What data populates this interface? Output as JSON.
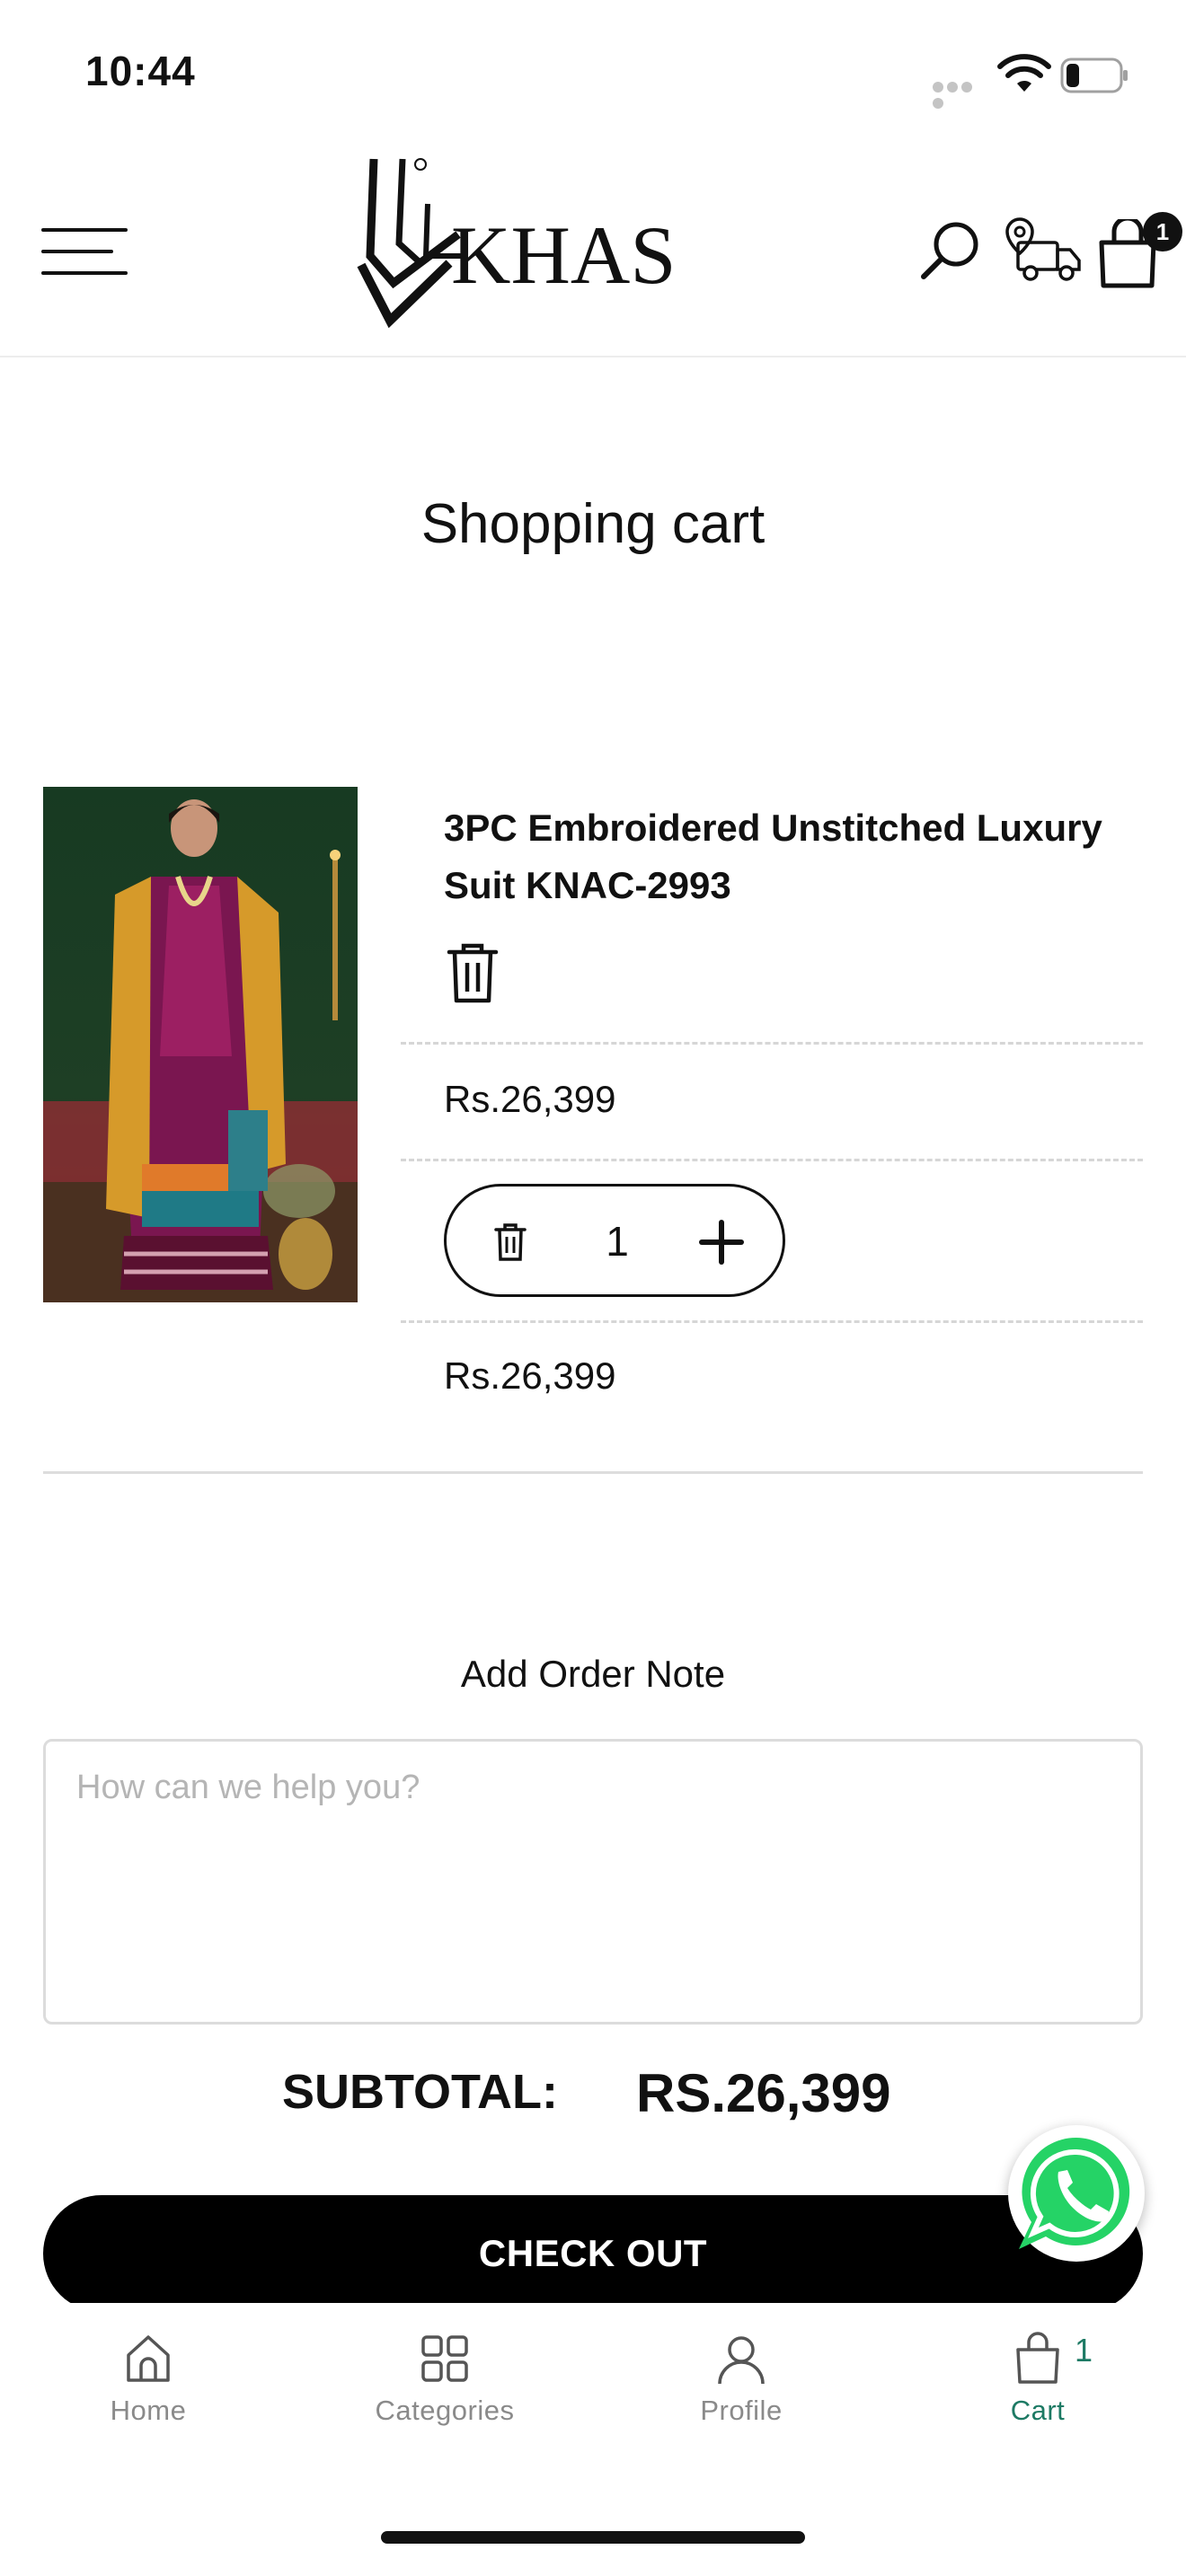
{
  "status_bar": {
    "time": "10:44"
  },
  "header": {
    "brand_name": "KHAS",
    "cart_count": "1"
  },
  "page": {
    "title": "Shopping cart"
  },
  "cart_item": {
    "name": "3PC Embroidered Unstitched Luxury Suit KNAC-2993",
    "unit_price": "Rs.26,399",
    "quantity": "1",
    "line_total": "Rs.26,399"
  },
  "order_note": {
    "title": "Add Order Note",
    "placeholder": "How can we help you?",
    "value": ""
  },
  "summary": {
    "subtotal_label": "SUBTOTAL:",
    "subtotal_value": "RS.26,399"
  },
  "checkout": {
    "label": "CHECK OUT"
  },
  "tab_bar": {
    "items": [
      {
        "label": "Home",
        "icon": "home-icon",
        "active": false
      },
      {
        "label": "Categories",
        "icon": "grid-icon",
        "active": false
      },
      {
        "label": "Profile",
        "icon": "user-icon",
        "active": false
      },
      {
        "label": "Cart",
        "icon": "shopping-bag-icon",
        "active": true
      }
    ],
    "cart_count": "1"
  },
  "colors": {
    "accent": "#1d7a64",
    "primary_button": "#000000",
    "whatsapp": "#25d366"
  }
}
